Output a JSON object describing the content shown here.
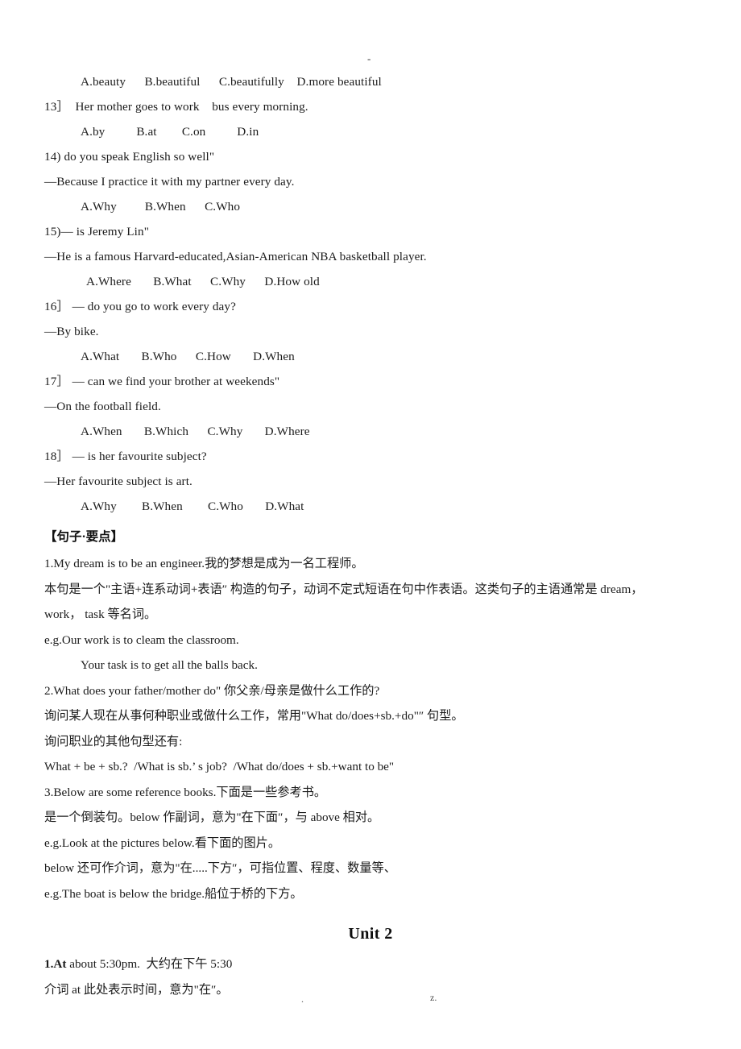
{
  "page": {
    "top_mark": "-",
    "footer_left_mark": ".",
    "footer_right_mark": "z."
  },
  "questions": [
    {
      "options_only": true,
      "options": [
        "A.beauty",
        "B.beautiful",
        "C.beautifully",
        "D.more beautiful"
      ]
    },
    {
      "number": "13］",
      "stem": "13］  Her mother goes to work    bus every morning.",
      "options": [
        "A.by",
        "B.at",
        "C.on",
        "D.in"
      ]
    },
    {
      "number": "14)",
      "stem": "14) do you speak English so well\"",
      "answer": "—Because I practice it with my partner every day.",
      "options": [
        "A.Why",
        "B.When",
        "C.Who"
      ]
    },
    {
      "number": "15)",
      "stem": "15)— is Jeremy Lin\"",
      "answer": "—He is a famous Harvard-educated,Asian-American NBA basketball player.",
      "options": [
        "A.Where",
        "B.What",
        "C.Why",
        "D.How old"
      ]
    },
    {
      "number": "16］",
      "stem": "16］ — do you go to work every day?",
      "answer": "—By bike.",
      "options": [
        "A.What",
        "B.Who",
        "C.How",
        "D.When"
      ]
    },
    {
      "number": "17］",
      "stem": "17］ — can we find your brother at weekends\"",
      "answer": "—On the football field.",
      "options": [
        "A.When",
        "B.Which",
        "C.Why",
        "D.Where"
      ]
    },
    {
      "number": "18］",
      "stem": "18］ — is her favourite subject?",
      "answer": "—Her favourite subject is art.",
      "options": [
        "A.Why",
        "B.When",
        "C.Who",
        "D.What"
      ]
    }
  ],
  "sentence_section": {
    "heading": "【句子·要点】",
    "items": [
      "1.My dream is to be an engineer.我的梦想是成为一名工程师。",
      "本句是一个\"主语+连系动词+表语″ 构造的句子，动词不定式短语在句中作表语。这类句子的主语通常是 dream，",
      "work， task 等名词。",
      "e.g.Our work is to cleam the classroom.",
      "Your task is to get all the balls back.",
      "2.What does your father/mother do\" 你父亲/母亲是做什么工作的?",
      "询问某人现在从事何种职业或做什么工作，常用\"What do/does+sb.+do\"″ 句型。",
      "询问职业的其他句型还有:",
      "What + be + sb.?  /What is sb.’ s job?  /What do/does + sb.+want to be\"",
      "3.Below are some reference books.下面是一些参考书。",
      "是一个倒装句。below 作副词，意为\"在下面″，与 above 相对。",
      "e.g.Look at the pictures below.看下面的图片。",
      "below 还可作介词，意为\"在.....下方″，可指位置、程度、数量等、",
      "e.g.The boat is below the bridge.船位于桥的下方。"
    ]
  },
  "unit2": {
    "heading": "Unit 2",
    "item_bold": "1.At",
    "item_rest": " about 5:30pm.  大约在下午 5:30",
    "note": "介词 at 此处表示时间，意为\"在″。"
  }
}
